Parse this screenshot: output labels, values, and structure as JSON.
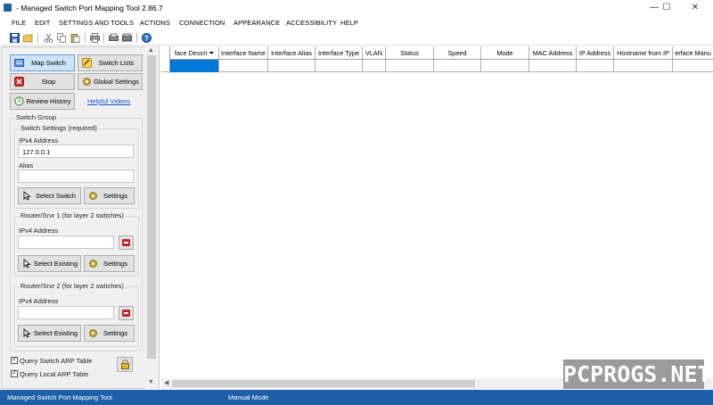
{
  "window": {
    "title": "- Managed Switch Port Mapping Tool 2.86.7",
    "minimize": "—",
    "maximize": "☐",
    "close": "✕"
  },
  "menu": [
    "FILE",
    "EDIT",
    "SETTINGS AND TOOLS",
    "ACTIONS",
    "CONNECTION",
    "APPEARANCE",
    "ACCESSIBILITY",
    "HELP"
  ],
  "toolbar": {
    "icons": [
      "save-icon",
      "open-folder-icon",
      "cut-icon",
      "copy-icon",
      "paste-icon",
      "print-icon",
      "print-preview-icon",
      "fax-icon",
      "help-icon"
    ]
  },
  "left_panel": {
    "map_switch": "Map Switch",
    "switch_lists": "Switch Lists",
    "stop": "Stop",
    "global_settings": "Global Settings",
    "review_history": "Review History",
    "helpful_videos": "Helpful Videos",
    "switch_group_title": "Switch Group",
    "switch_settings": {
      "title": "Switch Settings (required)",
      "ipv4_label": "IPv4 Address",
      "ipv4_value": "127.0.0.1",
      "alias_label": "Alias",
      "alias_value": "",
      "select_switch": "Select Switch",
      "settings": "Settings"
    },
    "router1": {
      "title": "Router/Srvr 1 (for layer 2 switches)",
      "ipv4_label": "IPv4 Address",
      "ipv4_value": "",
      "select_existing": "Select Existing",
      "settings": "Settings"
    },
    "router2": {
      "title": "Router/Srvr 2 (for layer 2 switches)",
      "ipv4_label": "IPv4 Address",
      "ipv4_value": "",
      "select_existing": "Select Existing",
      "settings": "Settings"
    },
    "query_switch_arp": "Query Switch ARP Table",
    "query_local_arp": "Query Local ARP Table"
  },
  "grid": {
    "columns": [
      "face Descri",
      "Interface Name",
      "Interface Alias",
      "Interface Type",
      "VLAN",
      "Status",
      "Speed",
      "Mode",
      "MAC Address",
      "IP Address",
      "Hostname from IP",
      "erface Manu"
    ],
    "sort_icon": "filter-sort-icon"
  },
  "watermark": "PCPROGS.NET",
  "status": {
    "app_name": "Managed Switch Port Mapping Tool",
    "mode": "Manual Mode"
  },
  "colors": {
    "accent": "#1d5fa8",
    "selection": "#0078d7",
    "danger": "#c0262d"
  }
}
